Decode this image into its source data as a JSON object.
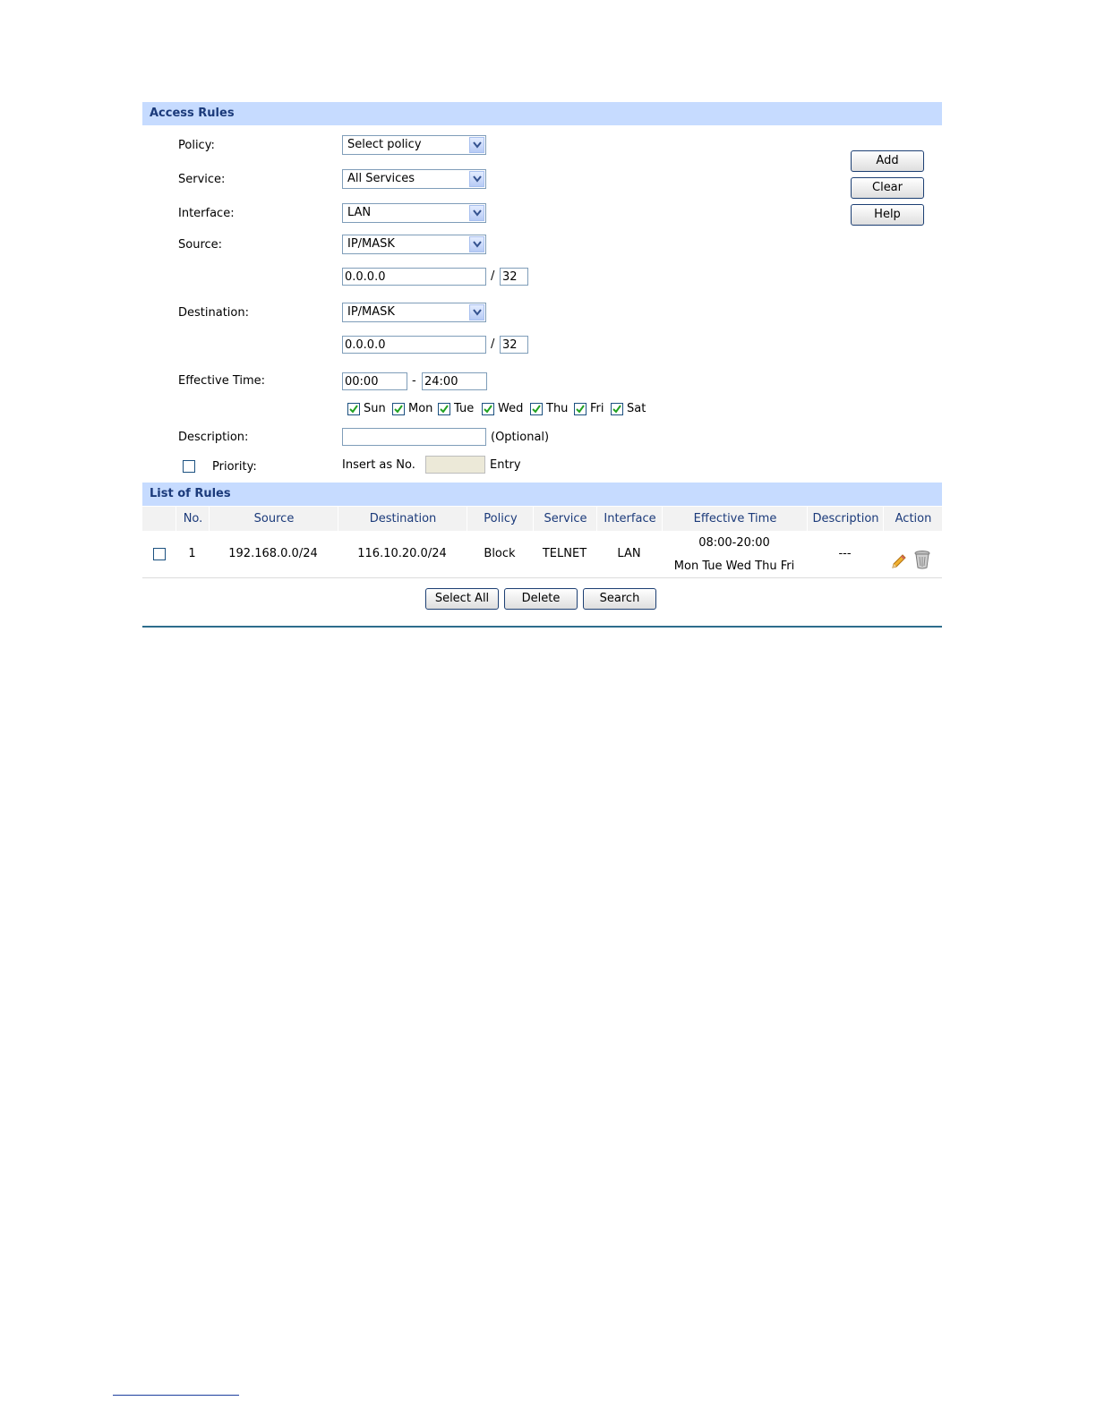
{
  "access_rules": {
    "title": "Access Rules",
    "policy": {
      "label": "Policy:",
      "value": "Select policy"
    },
    "service": {
      "label": "Service:",
      "value": "All Services"
    },
    "interface": {
      "label": "Interface:",
      "value": "LAN"
    },
    "source": {
      "label": "Source:",
      "type": "IP/MASK",
      "ip": "0.0.0.0",
      "mask": "32"
    },
    "destination": {
      "label": "Destination:",
      "type": "IP/MASK",
      "ip": "0.0.0.0",
      "mask": "32"
    },
    "slash": "/",
    "effective_time": {
      "label": "Effective Time:",
      "start": "00:00",
      "dash": "-",
      "end": "24:00",
      "days": [
        {
          "label": "Sun",
          "checked": true
        },
        {
          "label": "Mon",
          "checked": true
        },
        {
          "label": "Tue",
          "checked": true
        },
        {
          "label": "Wed",
          "checked": true
        },
        {
          "label": "Thu",
          "checked": true
        },
        {
          "label": "Fri",
          "checked": true
        },
        {
          "label": "Sat",
          "checked": true
        }
      ]
    },
    "description": {
      "label": "Description:",
      "value": "",
      "hint": "(Optional)"
    },
    "priority": {
      "label": "Priority:",
      "checked": false,
      "insert_prefix": "Insert as No.",
      "value": "",
      "suffix": "Entry"
    },
    "buttons": {
      "add": "Add",
      "clear": "Clear",
      "help": "Help"
    }
  },
  "list_of_rules": {
    "title": "List of Rules",
    "columns": [
      "No.",
      "Source",
      "Destination",
      "Policy",
      "Service",
      "Interface",
      "Effective Time",
      "Description",
      "Action"
    ],
    "rows": [
      {
        "no": "1",
        "source": "192.168.0.0/24",
        "destination": "116.10.20.0/24",
        "policy": "Block",
        "service": "TELNET",
        "interface": "LAN",
        "time": "08:00-20:00",
        "days": "Mon Tue Wed Thu Fri",
        "description": "---",
        "actions": [
          "edit-icon",
          "delete-icon"
        ]
      }
    ],
    "buttons": {
      "select_all": "Select All",
      "delete": "Delete",
      "search": "Search"
    }
  },
  "colors": {
    "header_bg": "#c6dbff",
    "header_text": "#1b3a7a",
    "rule_line": "#2d6d8c"
  }
}
